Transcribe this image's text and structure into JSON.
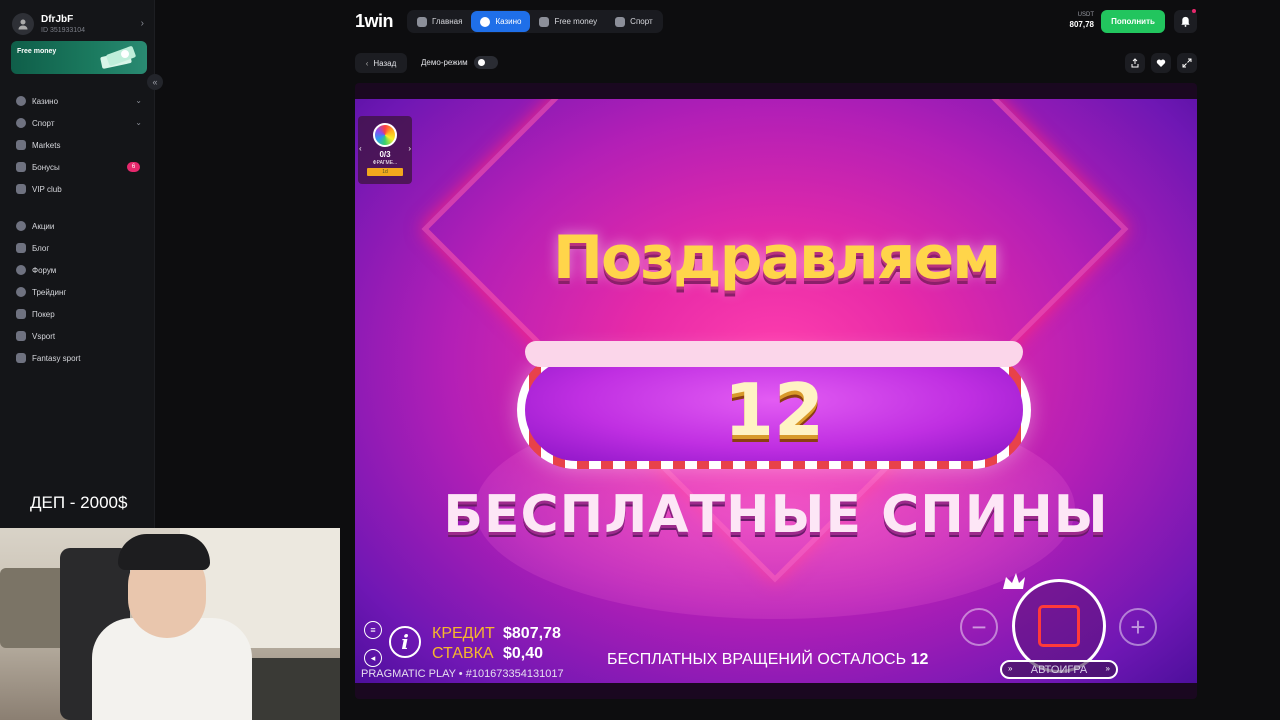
{
  "user": {
    "name": "DfrJbF",
    "id": "ID 351933104"
  },
  "promo": {
    "label": "Free money"
  },
  "sidebar": {
    "items": [
      {
        "label": "Казино",
        "has_chevron": true,
        "icon": "casino-icon"
      },
      {
        "label": "Спорт",
        "has_chevron": true,
        "icon": "sport-icon"
      },
      {
        "label": "Markets",
        "icon": "markets-icon"
      },
      {
        "label": "Бонусы",
        "badge": "6",
        "icon": "gift-icon"
      },
      {
        "label": "VIP club",
        "icon": "crown-icon"
      }
    ],
    "items2": [
      {
        "label": "Акции",
        "icon": "promo-icon"
      },
      {
        "label": "Блог",
        "icon": "blog-icon"
      },
      {
        "label": "Форум",
        "icon": "forum-icon"
      },
      {
        "label": "Трейдинг",
        "icon": "trading-icon"
      },
      {
        "label": "Покер",
        "icon": "poker-icon"
      },
      {
        "label": "Vsport",
        "icon": "vsport-icon"
      },
      {
        "label": "Fantasy sport",
        "icon": "trophy-icon"
      }
    ]
  },
  "overlay": {
    "dep_label": "ДЕП - 2000$"
  },
  "header": {
    "logo": "1win",
    "tabs": [
      {
        "label": "Главная",
        "active": false,
        "icon": "home-icon"
      },
      {
        "label": "Казино",
        "active": true,
        "icon": "casino-icon"
      },
      {
        "label": "Free money",
        "active": false,
        "icon": "money-icon"
      },
      {
        "label": "Спорт",
        "active": false,
        "icon": "sport-icon"
      }
    ],
    "balance_currency": "USDT",
    "balance_value": "807,78",
    "deposit_label": "Пополнить"
  },
  "toolbar": {
    "back_label": "Назад",
    "demo_label": "Демо-режим"
  },
  "game": {
    "fragment": {
      "count": "0/3",
      "label": "ФРАГМЕ...",
      "tag": "1d"
    },
    "congrats": "Поздравляем",
    "spins_won": "12",
    "free_spins_title": "БЕСПЛАТНЫЕ СПИНЫ",
    "credit_label": "КРЕДИТ",
    "credit_value": "$807,78",
    "bet_label": "СТАВКА",
    "bet_value": "$0,40",
    "provider_line": "PRAGMATIC PLAY • #101673354131017",
    "spins_left_label": "БЕСПЛАТНЫХ ВРАЩЕНИЙ ОСТАЛОСЬ",
    "spins_left_value": "12",
    "autoplay_label": "АВТОИГРА"
  },
  "colors": {
    "accent": "#1f6fe8",
    "deposit": "#22c55e",
    "badge": "#e5286c"
  }
}
